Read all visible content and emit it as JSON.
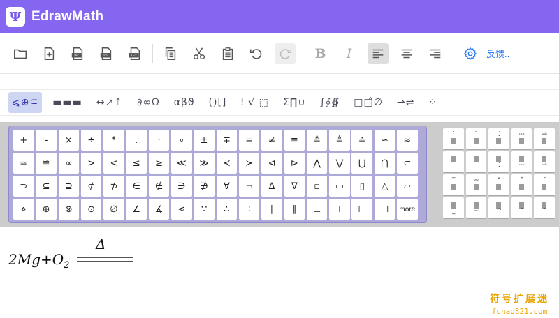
{
  "app": {
    "title": "EdrawMath",
    "logo_glyph": "Ψ"
  },
  "toolbar": {
    "feedback_label": "反馈..",
    "bold_label": "B",
    "italic_label": "I",
    "buttons": [
      "open",
      "new",
      "export-pic",
      "export-xml",
      "export-tex",
      "copy",
      "cut",
      "paste",
      "undo",
      "redo",
      "bold",
      "italic",
      "align-left",
      "align-center",
      "align-right",
      "settings"
    ]
  },
  "categories": [
    {
      "label": "⩽⊕⊆"
    },
    {
      "label": "▬▬▬"
    },
    {
      "label": "↔↗⇑"
    },
    {
      "label": "∂∞Ω"
    },
    {
      "label": "αβϑ"
    },
    {
      "label": "()[]"
    },
    {
      "label": "⁞ √ ⬚"
    },
    {
      "label": "Σ∏∪"
    },
    {
      "label": "∫∮∯"
    },
    {
      "label": "□□̂∅"
    },
    {
      "label": "⇀⇌"
    },
    {
      "label": "⁘"
    }
  ],
  "symbols": [
    "+",
    "-",
    "×",
    "÷",
    "*",
    ".",
    "·",
    "∘",
    "±",
    "∓",
    "=",
    "≠",
    "≡",
    "≙",
    "≜",
    "≐",
    "∽",
    "≈",
    "≃",
    "≌",
    "∝",
    ">",
    "<",
    "≤",
    "≥",
    "≪",
    "≫",
    "≺",
    "≻",
    "⊲",
    "⊳",
    "⋀",
    "⋁",
    "⋃",
    "⋂",
    "⊂",
    "⊃",
    "⊆",
    "⊇",
    "⊄",
    "⊅",
    "∈",
    "∉",
    "∋",
    "∌",
    "∀",
    "¬",
    "∆",
    "∇",
    "▫",
    "▭",
    "▯",
    "△",
    "▱",
    "⋄",
    "⊕",
    "⊗",
    "⊙",
    "∅",
    "∠",
    "∡",
    "⋖",
    "∵",
    "∴",
    "∶",
    "∣",
    "∥",
    "⊥",
    "⊤",
    "⊢",
    "⊣",
    "more"
  ],
  "accent_marks": [
    "˙",
    "¨",
    "⁚",
    "⋯",
    "→",
    "˙",
    "¨",
    "⁚",
    "⋯",
    "⇀",
    "‾",
    "~",
    "^",
    "ˇ",
    "˘",
    "_",
    "~",
    "^",
    "ˇ",
    "˘"
  ],
  "editor": {
    "formula_main": "2Mg+O",
    "formula_sub": "2",
    "arrow_label": "Δ"
  },
  "watermark": {
    "line1": "符号扩展迷",
    "line2": "fuhao321.com"
  }
}
